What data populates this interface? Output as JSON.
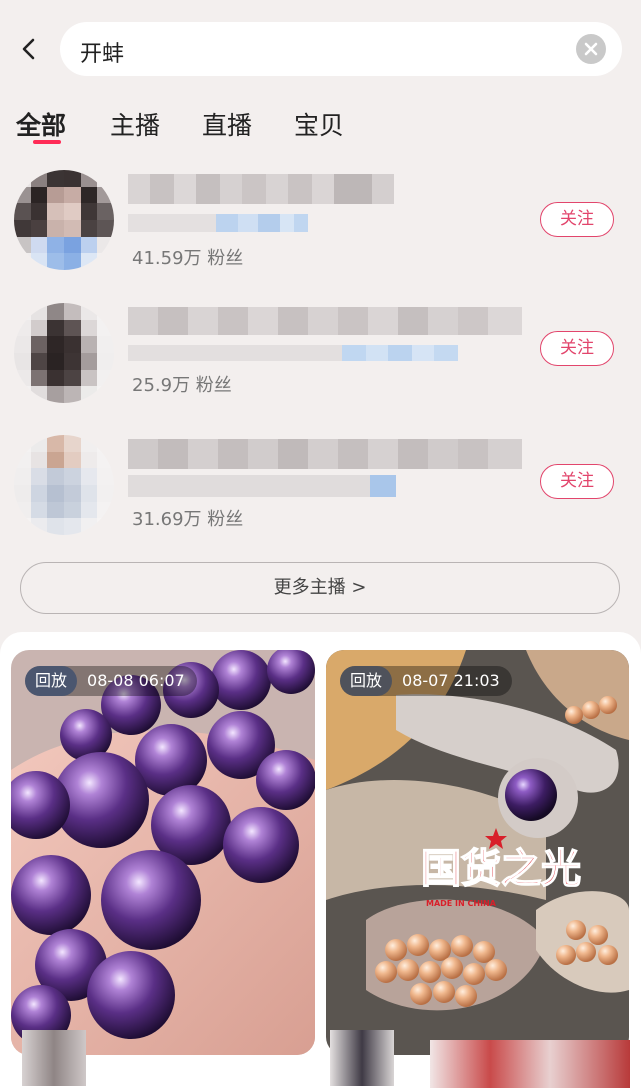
{
  "search": {
    "query": "开蚌"
  },
  "tabs": [
    {
      "label": "全部",
      "active": true
    },
    {
      "label": "主播",
      "active": false
    },
    {
      "label": "直播",
      "active": false
    },
    {
      "label": "宝贝",
      "active": false
    }
  ],
  "anchors": [
    {
      "followers": "41.59万 粉丝",
      "follow_label": "关注"
    },
    {
      "followers": "25.9万 粉丝",
      "follow_label": "关注"
    },
    {
      "followers": "31.69万 粉丝",
      "follow_label": "关注"
    }
  ],
  "more_anchors_label": "更多主播 >",
  "cards": [
    {
      "replay_label": "回放",
      "time": "08-08 06:07",
      "image": "purple-pearls"
    },
    {
      "replay_label": "回放",
      "time": "08-07 21:03",
      "image": "oyster-pearls",
      "overlay_text": "国货之光",
      "overlay_sub": "MADE IN CHINA"
    }
  ],
  "colors": {
    "accent": "#e2456c",
    "tab_indicator": "#ff2b56",
    "background": "#f3efee"
  }
}
